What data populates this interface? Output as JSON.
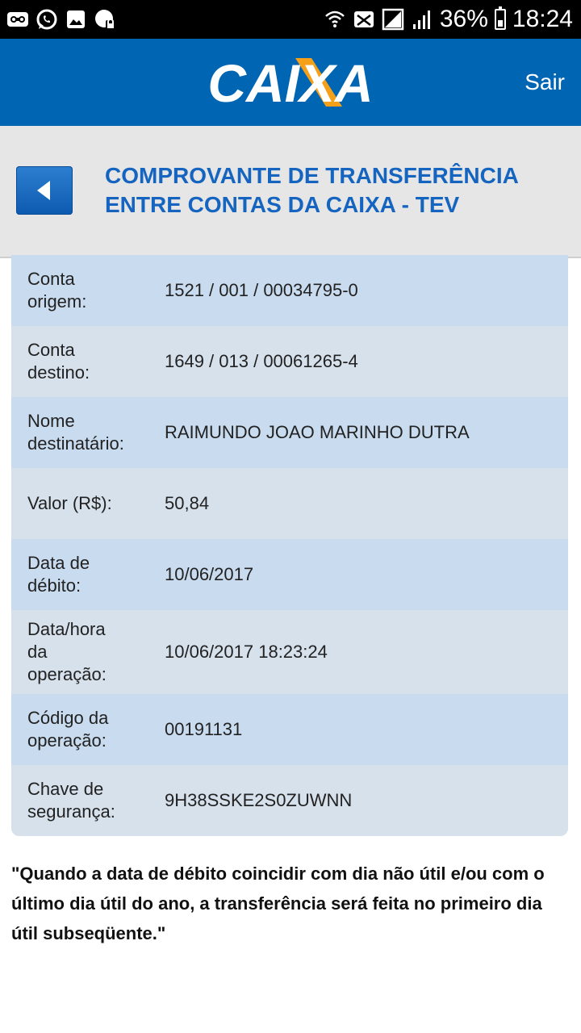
{
  "status_bar": {
    "battery": "36%",
    "time": "18:24",
    "left_icons": [
      "voicemail-icon",
      "whatsapp-icon",
      "gallery-icon",
      "vpn-icon"
    ],
    "right_icons": [
      "wifi-icon",
      "message-icon",
      "no-signal-icon",
      "signal-icon",
      "battery-icon"
    ]
  },
  "header": {
    "logo_text": "CAIXA",
    "logout_label": "Sair",
    "colors": {
      "brand_blue": "#0066b3",
      "brand_orange": "#f6a01a"
    }
  },
  "title_section": {
    "back_icon": "back-arrow-icon",
    "title_line1": "COMPROVANTE DE TRANSFERÊNCIA",
    "title_line2": "ENTRE CONTAS DA CAIXA - TEV"
  },
  "receipt": {
    "rows": [
      {
        "label_lines": [
          "Conta",
          "origem:"
        ],
        "value": "1521 / 001 / 00034795-0"
      },
      {
        "label_lines": [
          "Conta",
          "destino:"
        ],
        "value": "1649 / 013 / 00061265-4"
      },
      {
        "label_lines": [
          "Nome",
          "destinatário:"
        ],
        "value": "RAIMUNDO JOAO MARINHO DUTRA"
      },
      {
        "label_lines": [
          "Valor (R$):"
        ],
        "value": "50,84"
      },
      {
        "label_lines": [
          "Data de",
          "débito:"
        ],
        "value": "10/06/2017"
      },
      {
        "label_lines": [
          "Data/hora",
          "da",
          "operação:"
        ],
        "value": "10/06/2017 18:23:24"
      },
      {
        "label_lines": [
          "Código da",
          "operação:"
        ],
        "value": "00191131"
      },
      {
        "label_lines": [
          "Chave de",
          "segurança:"
        ],
        "value": "9H38SSKE2S0ZUWNN"
      }
    ]
  },
  "footer_note": {
    "line1": "\"Quando a data de débito coincidir com dia não útil e/ou com o",
    "line2": "último dia útil do ano, a transferência será feita no primeiro dia",
    "line3": "útil subseqüente.\""
  }
}
